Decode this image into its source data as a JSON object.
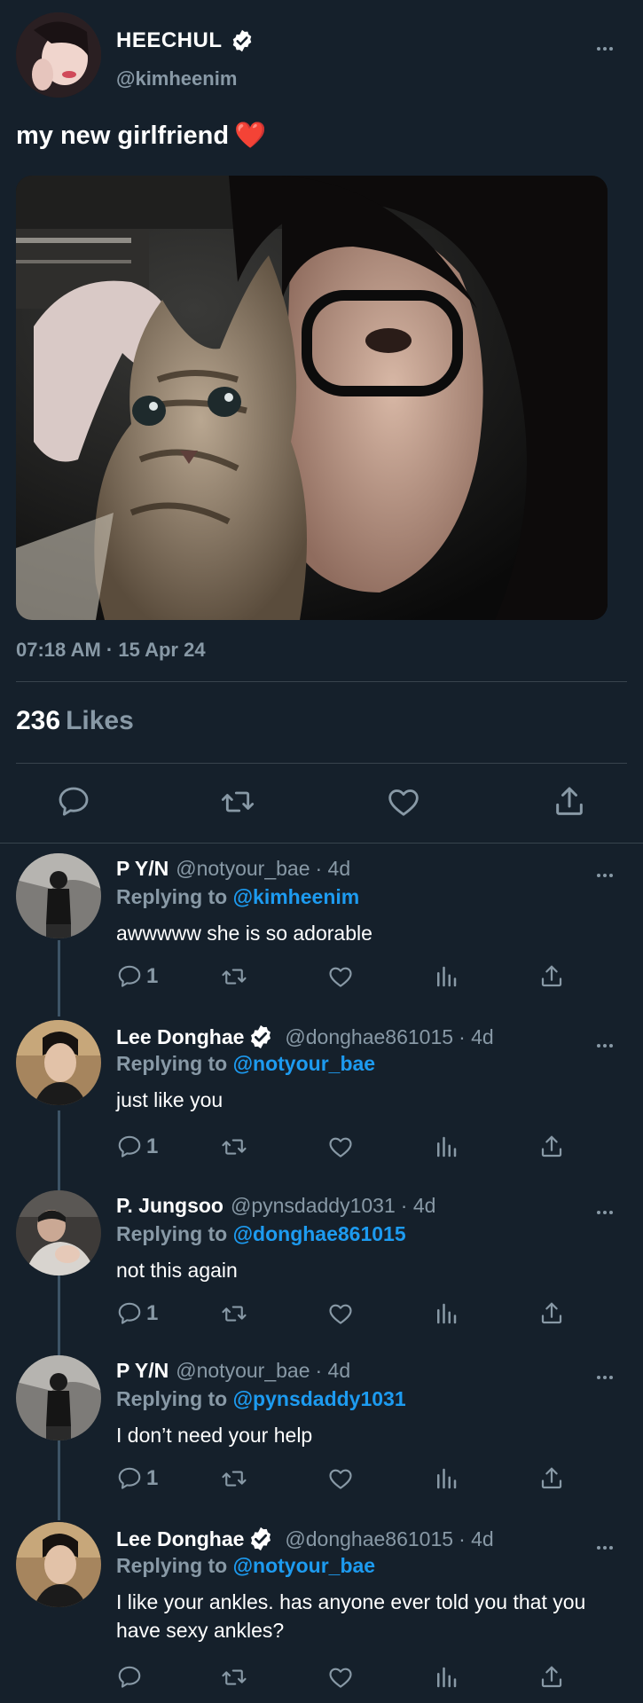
{
  "tweet": {
    "author_name": "HEECHUL",
    "author_handle": "@kimheenim",
    "text": "my new girlfriend",
    "emoji": "❤️",
    "timestamp": "07:18 AM · 15 Apr 24",
    "likes_count": "236",
    "likes_label": "Likes"
  },
  "replies": [
    {
      "name": "P Y/N",
      "handle": "@notyour_bae",
      "time": "· 4d",
      "replying_prefix": "Replying to",
      "replying_to": "@kimheenim",
      "text": "awwwww she is so adorable",
      "reply_count": "1",
      "verified": false
    },
    {
      "name": "Lee Donghae",
      "handle": "@donghae861015",
      "time": "· 4d",
      "replying_prefix": "Replying to",
      "replying_to": "@notyour_bae",
      "text": "just like you",
      "reply_count": "1",
      "verified": true
    },
    {
      "name": "P. Jungsoo",
      "handle": "@pynsdaddy1031",
      "time": "· 4d",
      "replying_prefix": "Replying to",
      "replying_to": "@donghae861015",
      "text": "not this again",
      "reply_count": "1",
      "verified": false
    },
    {
      "name": "P Y/N",
      "handle": "@notyour_bae",
      "time": "· 4d",
      "replying_prefix": "Replying to",
      "replying_to": "@pynsdaddy1031",
      "text": "I don’t need your help",
      "reply_count": "1",
      "verified": false
    },
    {
      "name": "Lee Donghae",
      "handle": "@donghae861015",
      "time": "· 4d",
      "replying_prefix": "Replying to",
      "replying_to": "@notyour_bae",
      "text": "I like your ankles. has anyone ever told you that you have sexy ankles?",
      "reply_count": "",
      "verified": true
    }
  ],
  "icons": {
    "reply": "reply-icon",
    "retweet": "retweet-icon",
    "like": "heart-icon",
    "analytics": "analytics-icon",
    "share": "share-icon",
    "more": "more-icon",
    "verified": "verified-badge-icon"
  },
  "colors": {
    "background": "#15202b",
    "muted": "#8899a6",
    "link": "#1d9bf0",
    "divider": "#38444d",
    "heart": "#e0245e"
  }
}
